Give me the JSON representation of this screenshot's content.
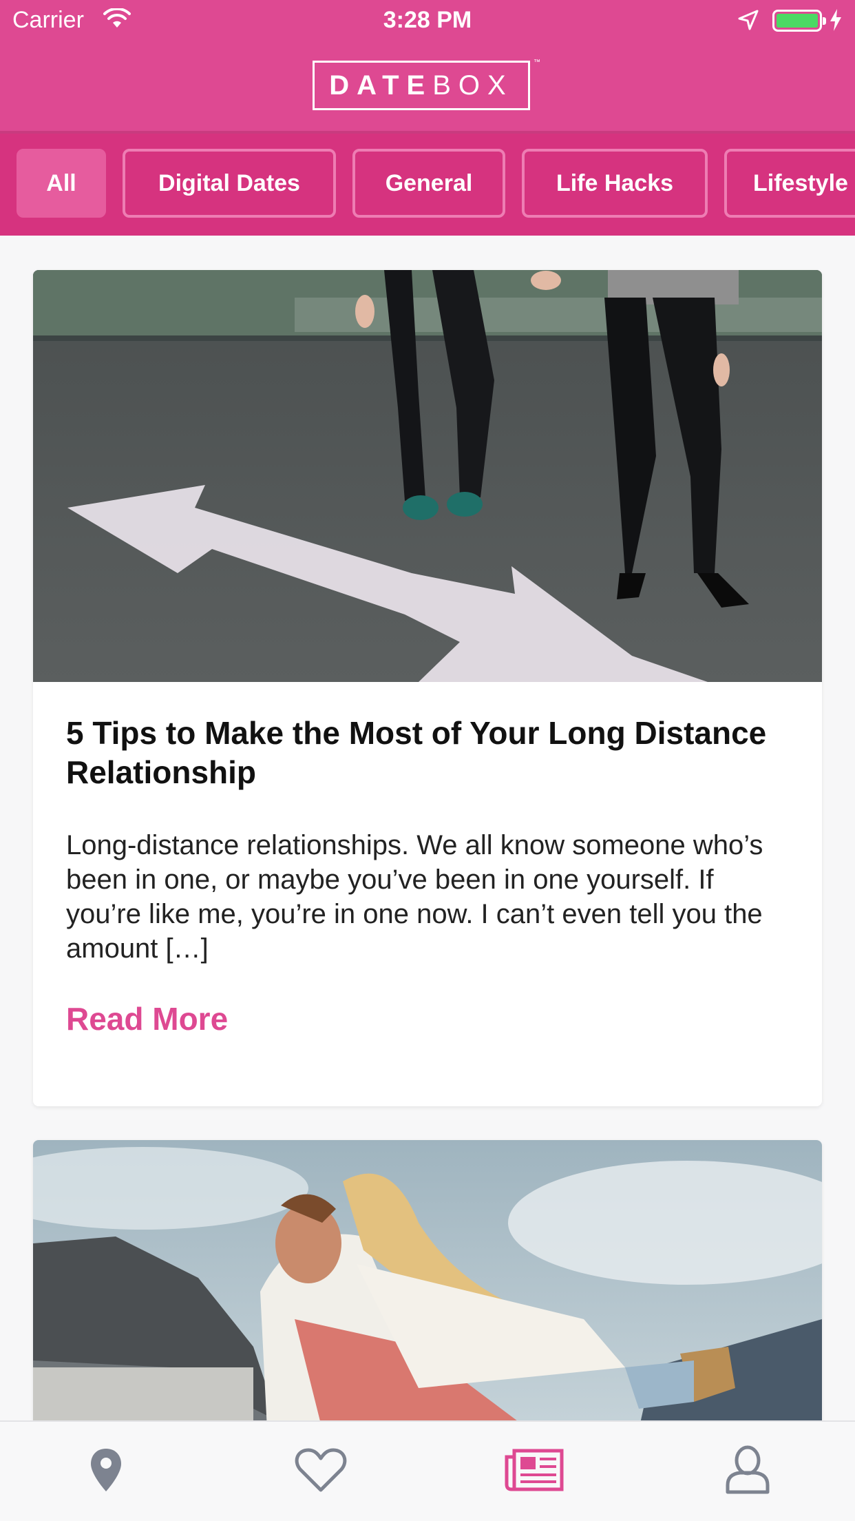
{
  "status_bar": {
    "carrier": "Carrier",
    "time": "3:28 PM"
  },
  "header": {
    "logo_bold": "DATE",
    "logo_thin": "BOX",
    "logo_tm": "™",
    "brand_color": "#de4992"
  },
  "filters": [
    {
      "label": "All",
      "active": true
    },
    {
      "label": "Digital Dates",
      "active": false
    },
    {
      "label": "General",
      "active": false
    },
    {
      "label": "Life Hacks",
      "active": false
    },
    {
      "label": "Lifestyle",
      "active": false
    }
  ],
  "articles": [
    {
      "title": "5 Tips to Make the Most of Your Long Distance Relationship",
      "excerpt": "Long-distance relationships. We all know someone who’s been in one, or maybe you’ve been in one yourself. If you’re like me, you’re in one now. I can’t even tell you the amount […]",
      "read_more": "Read More",
      "image": "couple-standing-by-arrow-photo"
    },
    {
      "image": "couple-embracing-mountains-photo"
    }
  ],
  "tabbar": {
    "items": [
      {
        "icon": "location-pin-icon",
        "active": false
      },
      {
        "icon": "heart-icon",
        "active": false
      },
      {
        "icon": "newspaper-icon",
        "active": true
      },
      {
        "icon": "user-icon",
        "active": false
      }
    ],
    "active_color": "#de4992",
    "inactive_color": "#7d8390"
  }
}
